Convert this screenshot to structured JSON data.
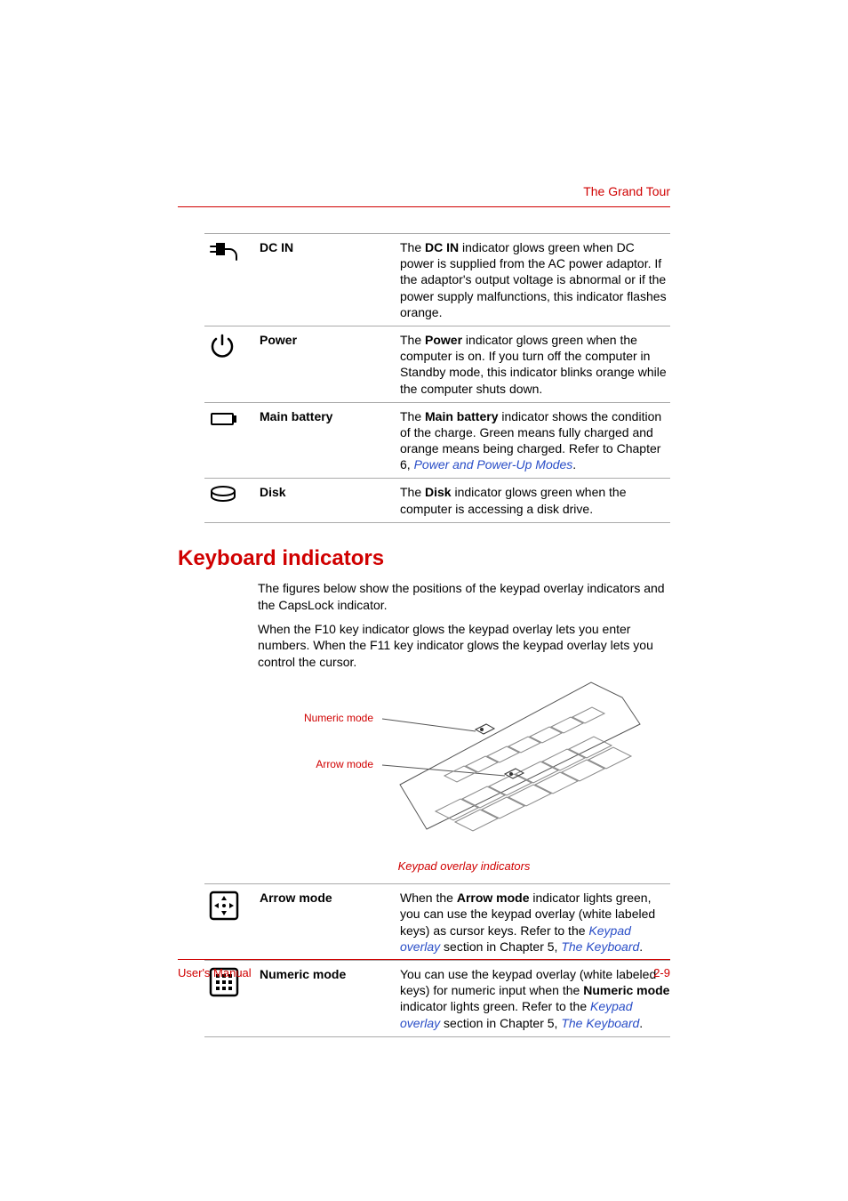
{
  "header": {
    "chapter_title": "The Grand Tour"
  },
  "table1": {
    "rows": [
      {
        "term": "DC IN",
        "desc_pre": "The ",
        "desc_bold": "DC IN",
        "desc_post": " indicator glows green when DC power is supplied from the AC power adaptor. If the adaptor's output voltage is abnormal or if the power supply malfunctions, this indicator flashes orange."
      },
      {
        "term": "Power",
        "desc_pre": "The ",
        "desc_bold": "Power",
        "desc_post": " indicator glows green when the computer is on. If you turn off the computer in Standby mode, this indicator blinks orange while the computer shuts down."
      },
      {
        "term": "Main battery",
        "desc_pre": "The ",
        "desc_bold": "Main battery",
        "desc_post": " indicator shows the condition of the charge. Green means fully charged and orange means being charged. Refer to Chapter 6, ",
        "link": "Power and Power-Up Modes",
        "tail": "."
      },
      {
        "term": "Disk",
        "desc_pre": "The ",
        "desc_bold": "Disk",
        "desc_post": " indicator glows green when the computer is accessing a disk drive."
      }
    ]
  },
  "section": {
    "heading": "Keyboard indicators",
    "para1": "The figures below show the positions of the keypad overlay indicators and the CapsLock indicator.",
    "para2": "When the F10 key indicator glows the keypad overlay lets you enter numbers. When the F11 key indicator glows the keypad overlay lets you control the cursor.",
    "figure_label_numeric": "Numeric mode",
    "figure_label_arrow": "Arrow mode",
    "figure_caption": "Keypad overlay indicators"
  },
  "table2": {
    "rows": [
      {
        "term": "Arrow mode",
        "desc_pre": "When the ",
        "desc_bold": "Arrow mode",
        "desc_mid": " indicator lights green, you can use the keypad overlay (white labeled keys) as cursor keys. Refer to the ",
        "link1": "Keypad overlay",
        "mid2": " section in Chapter 5, ",
        "link2": "The Keyboard",
        "tail": "."
      },
      {
        "term": "Numeric mode",
        "desc_pre": "You can use the keypad overlay (white labeled keys) for numeric input when the ",
        "desc_bold": "Numeric mode",
        "desc_mid": " indicator lights green. Refer to the ",
        "link1": "Keypad overlay",
        "mid2": " section in Chapter 5, ",
        "link2": "The Keyboard",
        "tail": "."
      }
    ]
  },
  "footer": {
    "left": "User's Manual",
    "right": "2-9"
  }
}
